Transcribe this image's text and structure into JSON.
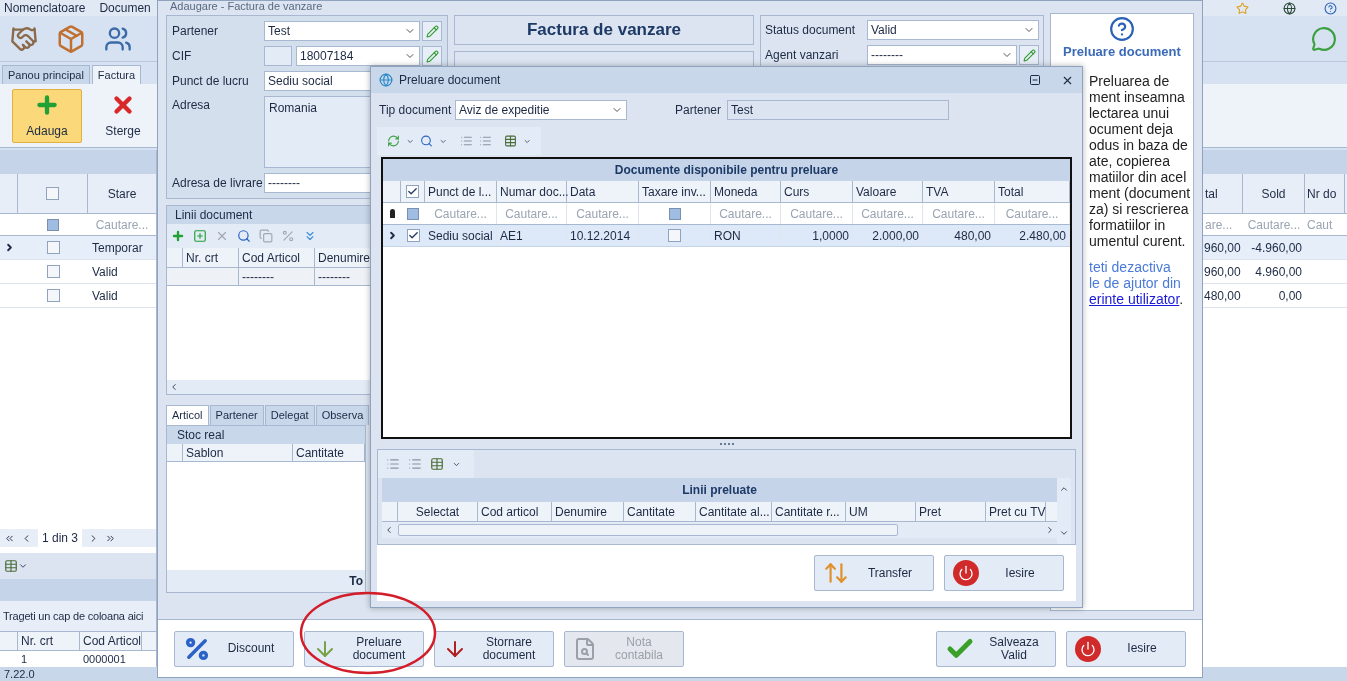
{
  "main_menu": [
    "Nomenclatoare",
    "Documen"
  ],
  "main_tabs": [
    {
      "label": "Panou principal",
      "selected": false
    },
    {
      "label": "Factura",
      "selected": true
    }
  ],
  "main_actions": [
    {
      "label": "Adauga",
      "kind": "add",
      "selected": true
    },
    {
      "label": "Sterge",
      "kind": "delete",
      "selected": false
    }
  ],
  "main_grid": {
    "all_checked": false,
    "filter_checked": false,
    "left_column": {
      "label": "Stare",
      "search": "Cautare..."
    },
    "right_columns": [
      {
        "label": "tal",
        "search": "are..."
      },
      {
        "label": "Sold",
        "search": "Cautare..."
      },
      {
        "label": "Nr do",
        "search": "Caut"
      }
    ],
    "rows": [
      {
        "selected": true,
        "checked": false,
        "stare": "Temporar",
        "tal": "960,00",
        "sold": "-4.960,00"
      },
      {
        "selected": false,
        "checked": false,
        "stare": "Valid",
        "tal": "960,00",
        "sold": "4.960,00"
      },
      {
        "selected": false,
        "checked": false,
        "stare": "Valid",
        "tal": "480,00",
        "sold": "0,00"
      }
    ],
    "pager": "1 din 3"
  },
  "lines_grid": {
    "group_hint": "Trageti un cap de coloana aici",
    "columns": [
      "Nr. crt",
      "Cod Articol"
    ],
    "rows": [
      [
        "1",
        "0000001"
      ]
    ]
  },
  "status_bar": "7.22.0",
  "invoice_window": {
    "title": "Adaugare - Factura de vanzare",
    "heading": "Factura de vanzare",
    "partner": {
      "label": "Partener",
      "value": "Test"
    },
    "cif": {
      "label": "CIF",
      "value": "18007184"
    },
    "workpoint": {
      "label": "Punct de lucru",
      "value": "Sediu social"
    },
    "address": {
      "label": "Adresa",
      "value": "Romania"
    },
    "delivery": {
      "label": "Adresa de livrare",
      "value": "--------"
    },
    "status": {
      "label": "Status document",
      "value": "Valid"
    },
    "agent": {
      "label": "Agent vanzari",
      "value": "--------"
    },
    "lines": {
      "title": "Linii document",
      "columns": [
        "Nr. crt",
        "Cod Articol",
        "Denumire"
      ],
      "filter": [
        "--------",
        "--------"
      ]
    },
    "tabs": [
      {
        "label": "Articol",
        "selected": true
      },
      {
        "label": "Partener",
        "selected": false
      },
      {
        "label": "Delegat",
        "selected": false
      },
      {
        "label": "Observa",
        "selected": false
      }
    ],
    "stock": {
      "title": "Stoc real",
      "columns": [
        "Sablon",
        "Cantitate"
      ],
      "footer": "To"
    },
    "buttons": [
      {
        "label": "Discount",
        "kind": "discount",
        "disabled": false
      },
      {
        "label": "Preluare document",
        "kind": "import",
        "disabled": false
      },
      {
        "label": "Stornare document",
        "kind": "reverse",
        "disabled": false
      },
      {
        "label": "Nota contabila",
        "kind": "ledger",
        "disabled": true
      },
      {
        "label": "Salveaza Valid",
        "kind": "save",
        "disabled": false
      },
      {
        "label": "Iesire",
        "kind": "exit",
        "disabled": false
      }
    ]
  },
  "help": {
    "title": "Preluare document",
    "lines": [
      "Preluarea de",
      "ment inseamna",
      "lectarea unui",
      "ocument deja",
      "odus in baza de",
      "ate, copierea",
      "matiilor din acel",
      "ment (document",
      "za) si rescrierea",
      "formatiilor in",
      "umentul curent."
    ],
    "note_lines": [
      "teti dezactiva",
      "le de ajutor din"
    ],
    "link": "erinte utilizator",
    "after_link": "."
  },
  "dialog": {
    "title": "Preluare document",
    "doc_type": {
      "label": "Tip document",
      "value": "Aviz de expeditie"
    },
    "partner": {
      "label": "Partener",
      "value": "Test"
    },
    "available": {
      "title": "Documente disponibile pentru preluare",
      "all_checked": true,
      "filter_checked": false,
      "columns": [
        {
          "label": "Punct de l...",
          "kind": "text",
          "search": "Cautare..."
        },
        {
          "label": "Numar doc...",
          "kind": "text",
          "search": "Cautare..."
        },
        {
          "label": "Data",
          "kind": "text",
          "search": "Cautare..."
        },
        {
          "label": "Taxare inv...",
          "kind": "check",
          "filter_checked": false
        },
        {
          "label": "Moneda",
          "kind": "text",
          "search": "Cautare..."
        },
        {
          "label": "Curs",
          "kind": "number",
          "search": "Cautare..."
        },
        {
          "label": "Valoare",
          "kind": "number",
          "search": "Cautare..."
        },
        {
          "label": "TVA",
          "kind": "number",
          "search": "Cautare..."
        },
        {
          "label": "Total",
          "kind": "number",
          "search": "Cautare..."
        }
      ],
      "rows": [
        {
          "selected": true,
          "checked": true,
          "cells": [
            "Sediu social",
            "AE1",
            "10.12.2014",
            false,
            "RON",
            "1,0000",
            "2.000,00",
            "480,00",
            "2.480,00"
          ]
        }
      ]
    },
    "taken": {
      "title": "Linii preluate",
      "columns": [
        "Selectat",
        "Cod articol",
        "Denumire",
        "Cantitate",
        "Cantitate al...",
        "Cantitate r...",
        "UM",
        "Pret",
        "Pret cu TV"
      ]
    },
    "buttons": [
      {
        "label": "Transfer",
        "kind": "transfer"
      },
      {
        "label": "Iesire",
        "kind": "exit"
      }
    ]
  }
}
